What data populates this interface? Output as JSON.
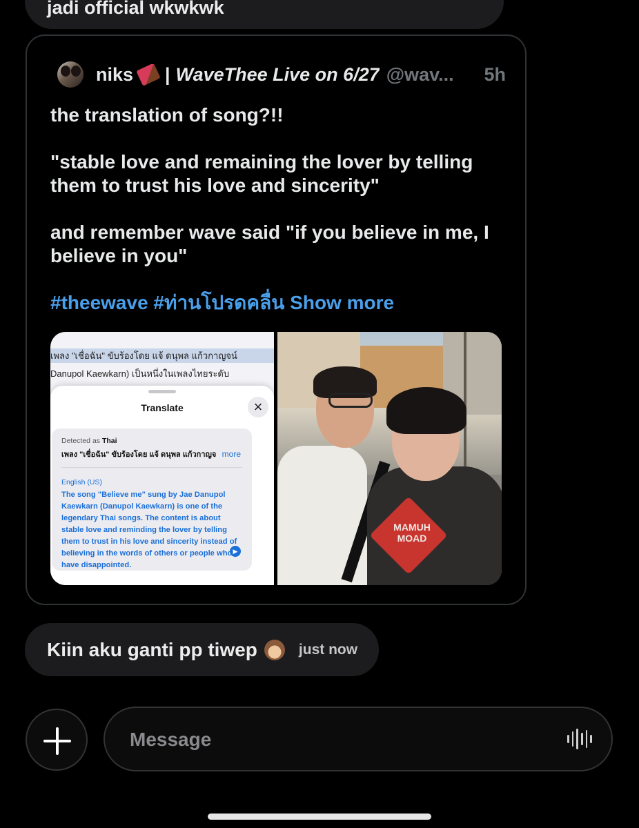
{
  "previous_message": {
    "text": "jadi official wkwkwk"
  },
  "quoted_post": {
    "author_name": "niks",
    "author_icon": "chocolate-bar-icon",
    "author_separator": "|",
    "author_suffix": "WaveThee Live on 6/27",
    "handle": "@wav...",
    "time": "5h",
    "body": {
      "line1": "the translation of song?!!",
      "line2": "\"stable love and remaining the lover by telling them to trust his love and sincerity\"",
      "line3": "and remember wave said \"if you believe in me, I believe in you\""
    },
    "hashtags": "#theewave #ท่านโปรดคลื่น",
    "show_more": "Show more",
    "media": {
      "left": {
        "doc_line1": "เพลง \"เชื่อฉัน\" ขับร้องโดย แจ้ ดนุพล แก้วกาญจน์",
        "doc_line2": "Danupol Kaewkarn) เป็นหนึ่งในเพลงไทยระดับ",
        "sheet_title": "Translate",
        "detected_prefix": "Detected as",
        "detected_lang": "Thai",
        "source_text": "เพลง \"เชื่อฉัน\" ขับร้องโดย แจ้ ดนุพล แก้วกาญจ",
        "more_label": "more",
        "target_lang": "English (US)",
        "translation": "The song \"Believe me\" sung by Jae Danupol Kaewkarn (Danupol Kaewkarn) is one of the legendary Thai songs. The content is about stable love and reminding the lover by telling them to trust in his love and sincerity instead of believing in the words of others or people who have disappointed."
      },
      "right": {
        "shirt_text": "MAMUH MOAD"
      }
    }
  },
  "reply_message": {
    "text": "Kiin aku ganti pp tiwep",
    "emoji_icon": "see-no-evil-monkey-icon",
    "time": "just now"
  },
  "composer": {
    "placeholder": "Message"
  },
  "colors": {
    "background": "#000000",
    "bubble": "#1c1c1e",
    "link": "#4a9fea",
    "muted": "#71767b"
  }
}
